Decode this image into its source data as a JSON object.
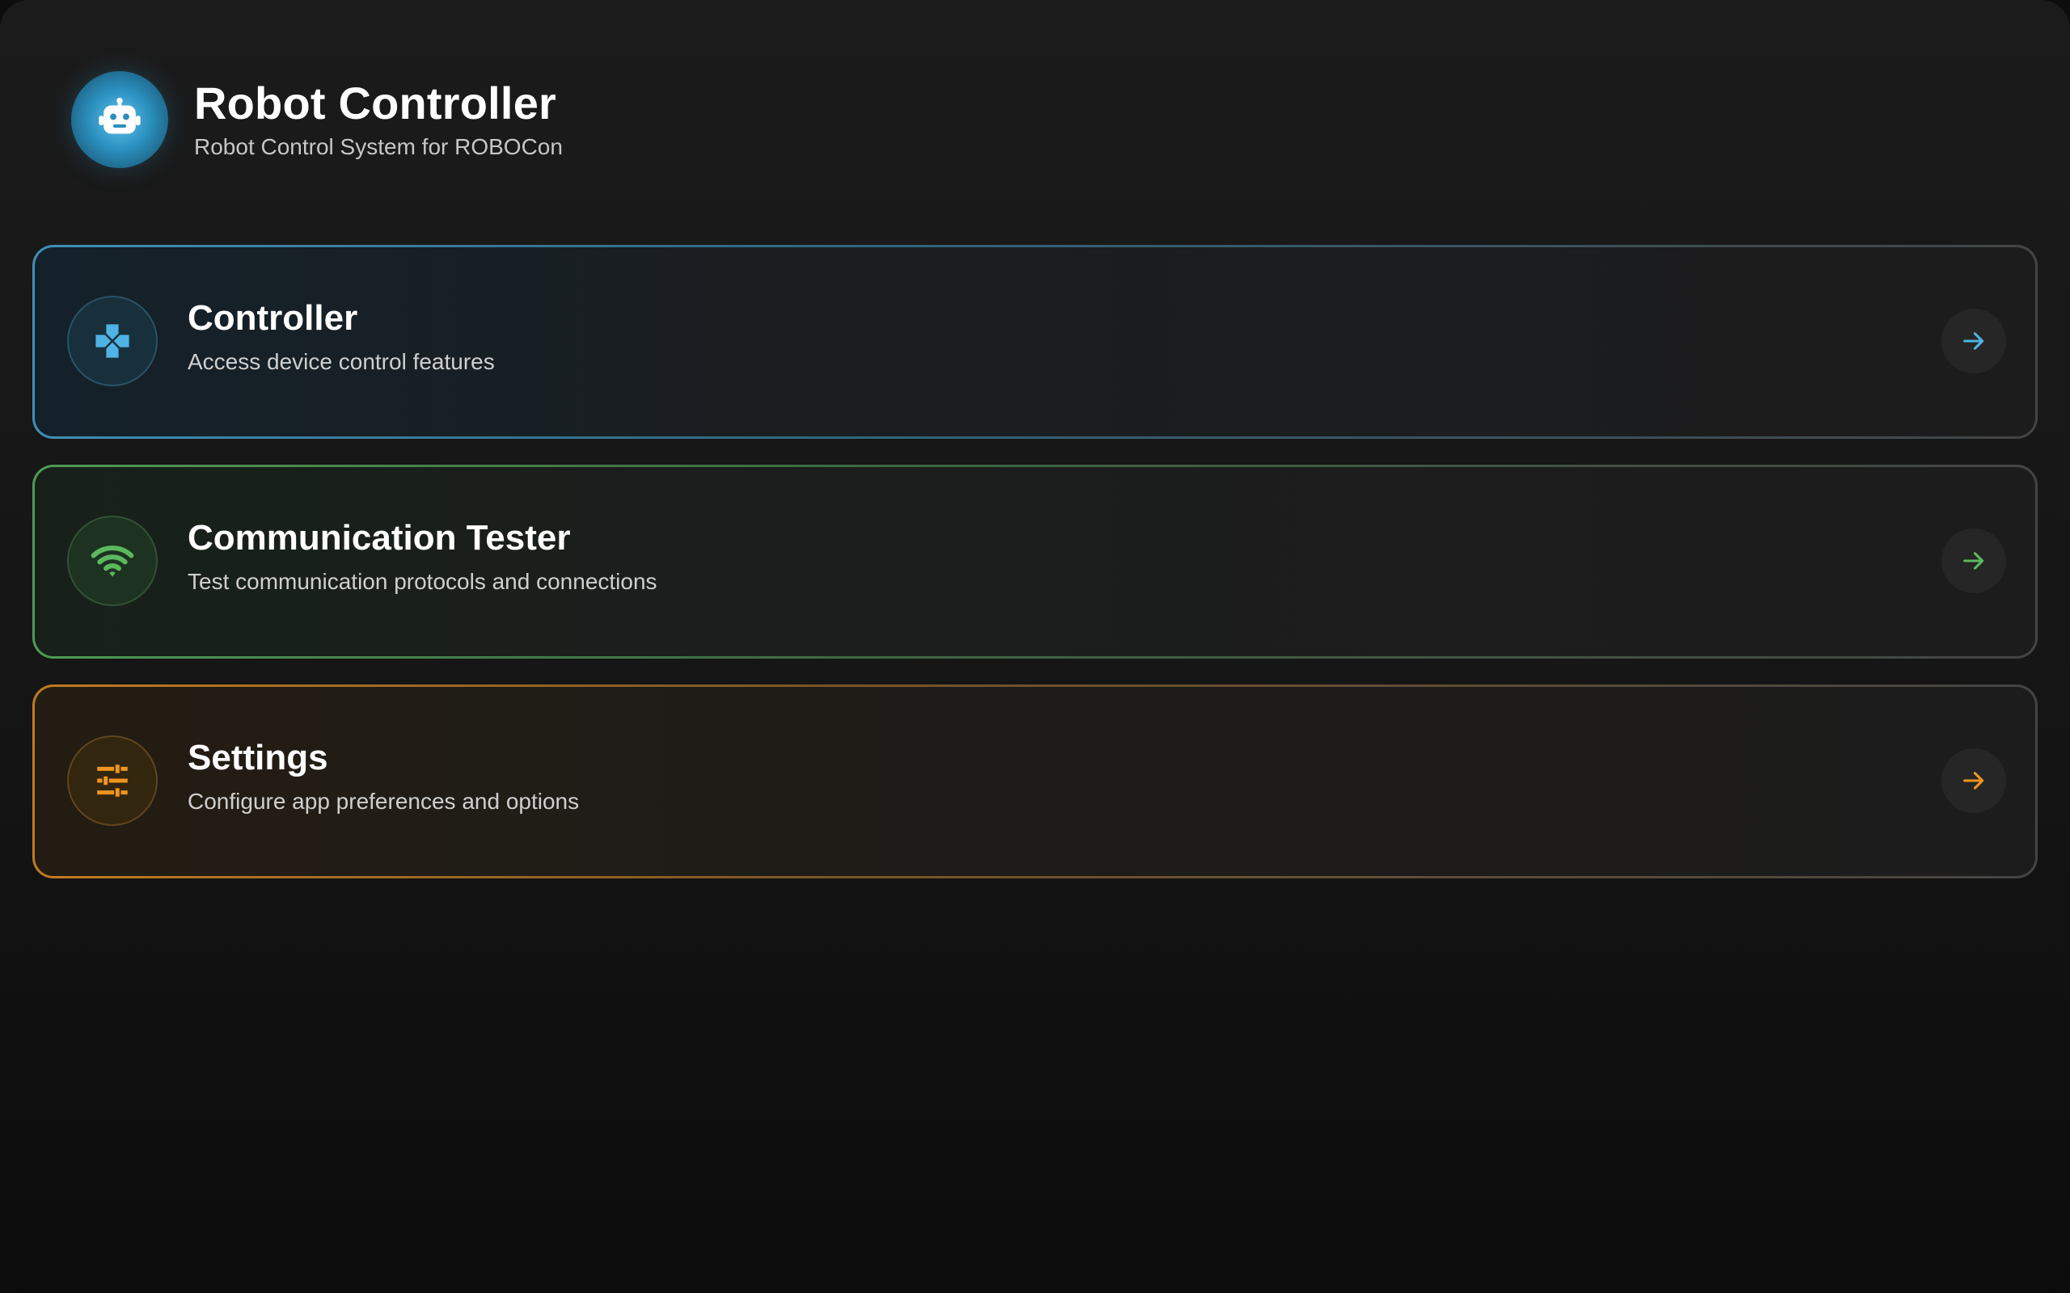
{
  "header": {
    "title": "Robot Controller",
    "subtitle": "Robot Control System for ROBOCon",
    "logo_icon": "robot-icon"
  },
  "cards": [
    {
      "title": "Controller",
      "description": "Access device control features",
      "icon": "gamepad-icon",
      "accent": "#4fb3e3"
    },
    {
      "title": "Communication Tester",
      "description": "Test communication protocols and connections",
      "icon": "wifi-icon",
      "accent": "#5cb85f"
    },
    {
      "title": "Settings",
      "description": "Configure app preferences and options",
      "icon": "sliders-icon",
      "accent": "#f0951e"
    }
  ],
  "colors": {
    "background": "#151515",
    "card_background": "#1c1c1c",
    "text_primary": "#ffffff",
    "text_secondary": "#cfcfcf"
  }
}
